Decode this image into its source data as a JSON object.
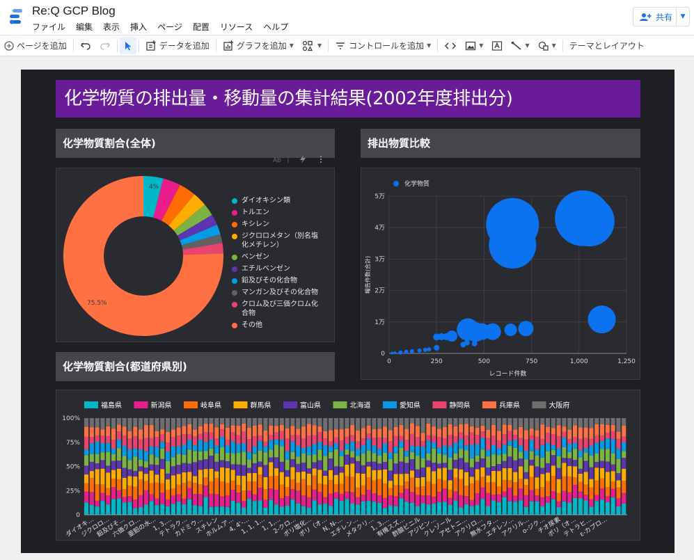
{
  "app": {
    "title": "Re:Q GCP Blog",
    "menu": [
      "ファイル",
      "編集",
      "表示",
      "挿入",
      "ページ",
      "配置",
      "リソース",
      "ヘルプ"
    ],
    "share_label": "共有"
  },
  "toolbar": {
    "add_page": "ページを追加",
    "add_data": "データを追加",
    "add_chart": "グラフを追加",
    "add_control": "コントロールを追加",
    "theme_layout": "テーマとレイアウト"
  },
  "report": {
    "title": "化学物質の排出量・移動量の集計結果(2002年度排出分)",
    "sections": {
      "overall": "化学物質割合(全体)",
      "compare": "排出物質比較",
      "prefecture": "化学物質割合(都道府県別)"
    }
  },
  "colors": {
    "accent_purple": "#6a1b9a",
    "canvas_bg": "#1e1f24",
    "panel_bg": "#2a2b31",
    "bubble": "#0b72f0"
  },
  "chart_data": [
    {
      "type": "pie",
      "name": "donut",
      "hole": true,
      "labels": [
        "ダイオキシン類",
        "トルエン",
        "キシレン",
        "ジクロロメタン（別名塩化メチレン）",
        "ベンゼン",
        "エチルベンゼン",
        "鉛及びその化合物",
        "マンガン及びその化合物",
        "クロム及び三価クロム化合物",
        "その他"
      ],
      "values": [
        4.0,
        3.6,
        3.4,
        2.9,
        2.5,
        2.2,
        2.0,
        1.8,
        2.1,
        75.5
      ],
      "colors": [
        "#00b7c8",
        "#e91e8c",
        "#ff6d00",
        "#ffab00",
        "#7cb342",
        "#5e35b1",
        "#039be5",
        "#616161",
        "#e8446e",
        "#ff7043"
      ],
      "data_labels": [
        "4%",
        "75.5%"
      ],
      "legend_position": "right"
    },
    {
      "type": "scatter",
      "name": "bubble",
      "legend": [
        "化学物質"
      ],
      "xlabel": "レコード件数",
      "ylabel": "報告件数(合計)",
      "xlim": [
        0,
        1250
      ],
      "ylim": [
        0,
        50000
      ],
      "xticks": [
        "0",
        "250",
        "500",
        "750",
        "1,000",
        "1,250"
      ],
      "yticks": [
        "0",
        "1万",
        "2万",
        "3万",
        "4万",
        "5万"
      ],
      "grid": true,
      "points": [
        {
          "x": 650,
          "y": 41000,
          "size": 38
        },
        {
          "x": 650,
          "y": 34500,
          "size": 34
        },
        {
          "x": 1020,
          "y": 43000,
          "size": 40
        },
        {
          "x": 1055,
          "y": 42000,
          "size": 36
        },
        {
          "x": 1120,
          "y": 10800,
          "size": 20
        },
        {
          "x": 415,
          "y": 7600,
          "size": 16
        },
        {
          "x": 455,
          "y": 6800,
          "size": 14
        },
        {
          "x": 490,
          "y": 6900,
          "size": 12
        },
        {
          "x": 545,
          "y": 6900,
          "size": 12
        },
        {
          "x": 640,
          "y": 7500,
          "size": 9
        },
        {
          "x": 720,
          "y": 7900,
          "size": 11
        },
        {
          "x": 250,
          "y": 5200,
          "size": 5
        },
        {
          "x": 275,
          "y": 5300,
          "size": 5
        },
        {
          "x": 300,
          "y": 5300,
          "size": 5
        },
        {
          "x": 330,
          "y": 5500,
          "size": 8
        },
        {
          "x": 410,
          "y": 3400,
          "size": 4
        },
        {
          "x": 450,
          "y": 3100,
          "size": 4
        },
        {
          "x": 390,
          "y": 2800,
          "size": 4
        },
        {
          "x": 250,
          "y": 1800,
          "size": 4
        },
        {
          "x": 160,
          "y": 900,
          "size": 3
        },
        {
          "x": 190,
          "y": 1100,
          "size": 3
        },
        {
          "x": 210,
          "y": 1300,
          "size": 3
        },
        {
          "x": 120,
          "y": 700,
          "size": 3
        },
        {
          "x": 90,
          "y": 500,
          "size": 3
        },
        {
          "x": 60,
          "y": 300,
          "size": 3
        },
        {
          "x": 30,
          "y": 200,
          "size": 2
        },
        {
          "x": 15,
          "y": 100,
          "size": 2
        }
      ]
    },
    {
      "type": "bar",
      "name": "stacked-100",
      "stacked_percent": true,
      "yticks": [
        "0",
        "25%",
        "50%",
        "75%",
        "100%"
      ],
      "legend_position": "top",
      "bar_count": 100,
      "series": [
        {
          "name": "福島県",
          "color": "#00b7c8",
          "share": 12
        },
        {
          "name": "新潟県",
          "color": "#e91e8c",
          "share": 10
        },
        {
          "name": "岐阜県",
          "color": "#ff6d00",
          "share": 12
        },
        {
          "name": "群馬県",
          "color": "#ffab00",
          "share": 11
        },
        {
          "name": "富山県",
          "color": "#5e35b1",
          "share": 9
        },
        {
          "name": "北海道",
          "color": "#7cb342",
          "share": 10
        },
        {
          "name": "愛知県",
          "color": "#039be5",
          "share": 9
        },
        {
          "name": "静岡県",
          "color": "#e8446e",
          "share": 9
        },
        {
          "name": "兵庫県",
          "color": "#ff7043",
          "share": 9
        },
        {
          "name": "大阪府",
          "color": "#6e6e6e",
          "share": 9
        }
      ],
      "category_labels": [
        "ダイオキ…",
        "ジクロロ…",
        "鉛及びそ…",
        "六価クロ…",
        "亜鉛の水…",
        "1, 3,…",
        "テトラク…",
        "カドミウ…",
        "スチレン",
        "ホルムア…",
        "4, 4'-…",
        "1, 1, 1…",
        "1, 1,…",
        "2-クロ…",
        "ポリ塩化…",
        "ポリ（オ…",
        "N, N-…",
        "エチレン…",
        "メタクリ…",
        "1, 3,…",
        "有機スズ…",
        "酢酸ビニル",
        "アジピン…",
        "クレゾール",
        "アセトニ…",
        "アクリロ…",
        "無水フタ…",
        "エチレン…",
        "アクリル…",
        "o-ジク…",
        "チオ尿素",
        "ポリ（オ…",
        "テトラヒ…",
        "ε-カプロ…"
      ]
    }
  ]
}
